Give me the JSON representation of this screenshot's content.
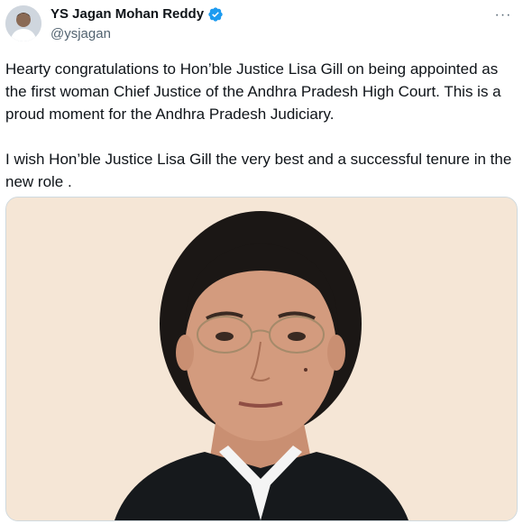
{
  "author": {
    "display_name": "YS Jagan Mohan Reddy",
    "handle": "@ysjagan",
    "verified": true,
    "verified_color": "#1d9bf0"
  },
  "more_label": "···",
  "tweet": {
    "paragraphs": [
      "Hearty congratulations to Hon’ble Justice Lisa Gill on being appointed as the first woman Chief Justice of the Andhra Pradesh High Court. This is a proud moment for the Andhra Pradesh Judiciary.",
      "I wish Hon’ble Justice Lisa Gill the very best and a successful tenure in the new role ."
    ]
  },
  "media": {
    "background_color": "#f5e6d6"
  }
}
